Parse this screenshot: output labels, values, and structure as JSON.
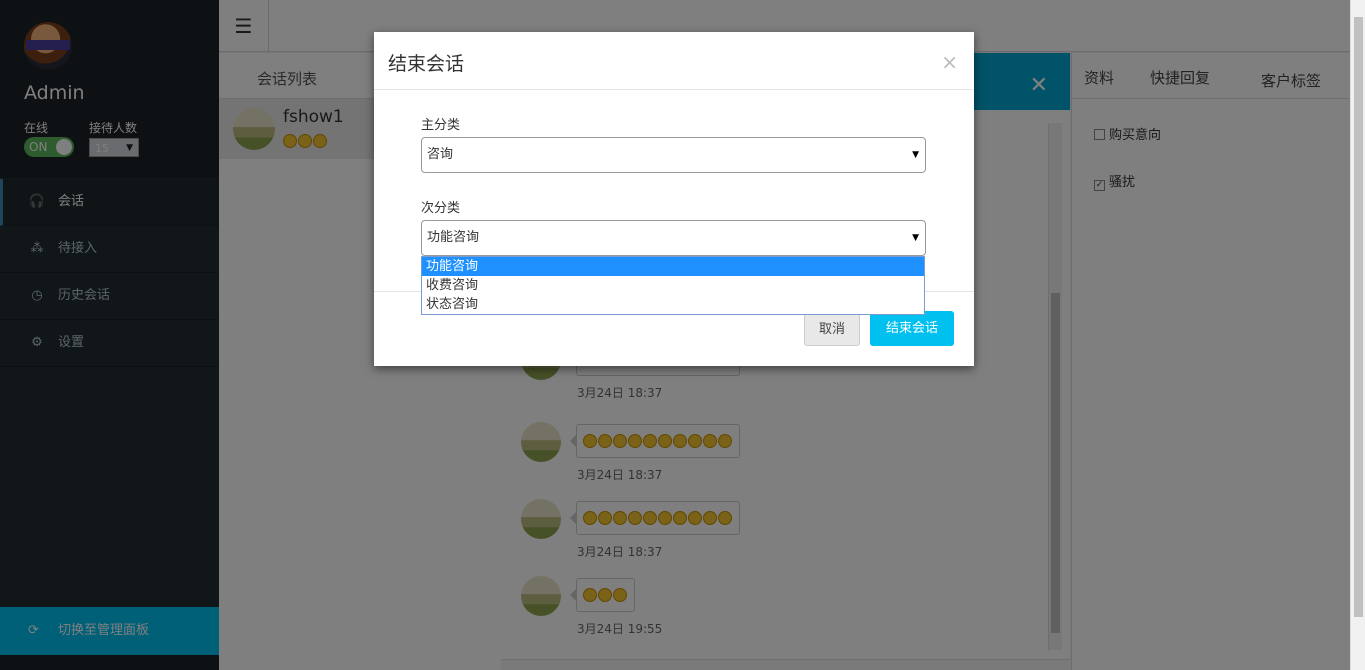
{
  "sidebar": {
    "user_name": "Admin",
    "online_label": "在线",
    "capacity_label": "接待人数",
    "toggle_label": "ON",
    "capacity_value": "15",
    "menu": [
      {
        "label": "会话",
        "icon": "headset-icon"
      },
      {
        "label": "待接入",
        "icon": "sitemap-icon"
      },
      {
        "label": "历史会话",
        "icon": "clock-icon"
      },
      {
        "label": "设置",
        "icon": "gear-icon"
      }
    ],
    "switch_label": "切换至管理面板"
  },
  "session_list": {
    "tab_label": "会话列表",
    "sessions": [
      {
        "name": "fshow1"
      }
    ]
  },
  "chat": {
    "messages": [
      {
        "time": "3月24日 18:37"
      },
      {
        "time": "3月24日 18:37"
      },
      {
        "time": "3月24日 18:37"
      },
      {
        "time": "3月24日 19:55"
      }
    ]
  },
  "right_panel": {
    "tabs": [
      "资料",
      "快捷回复",
      "客户标签"
    ],
    "tags": [
      {
        "label": "购买意向",
        "checked": false
      },
      {
        "label": "骚扰",
        "checked": true
      }
    ]
  },
  "modal": {
    "title": "结束会话",
    "close_glyph": "×",
    "primary_label": "主分类",
    "primary_value": "咨询",
    "secondary_label": "次分类",
    "secondary_value": "功能咨询",
    "secondary_options": [
      "功能咨询",
      "收费咨询",
      "状态咨询"
    ],
    "cancel_label": "取消",
    "end_label": "结束会话"
  },
  "colors": {
    "accent": "#00c0ef",
    "sidebar_bg": "#222d32",
    "toggle_on": "#5cb85c",
    "selected_option": "#1e90ff"
  }
}
